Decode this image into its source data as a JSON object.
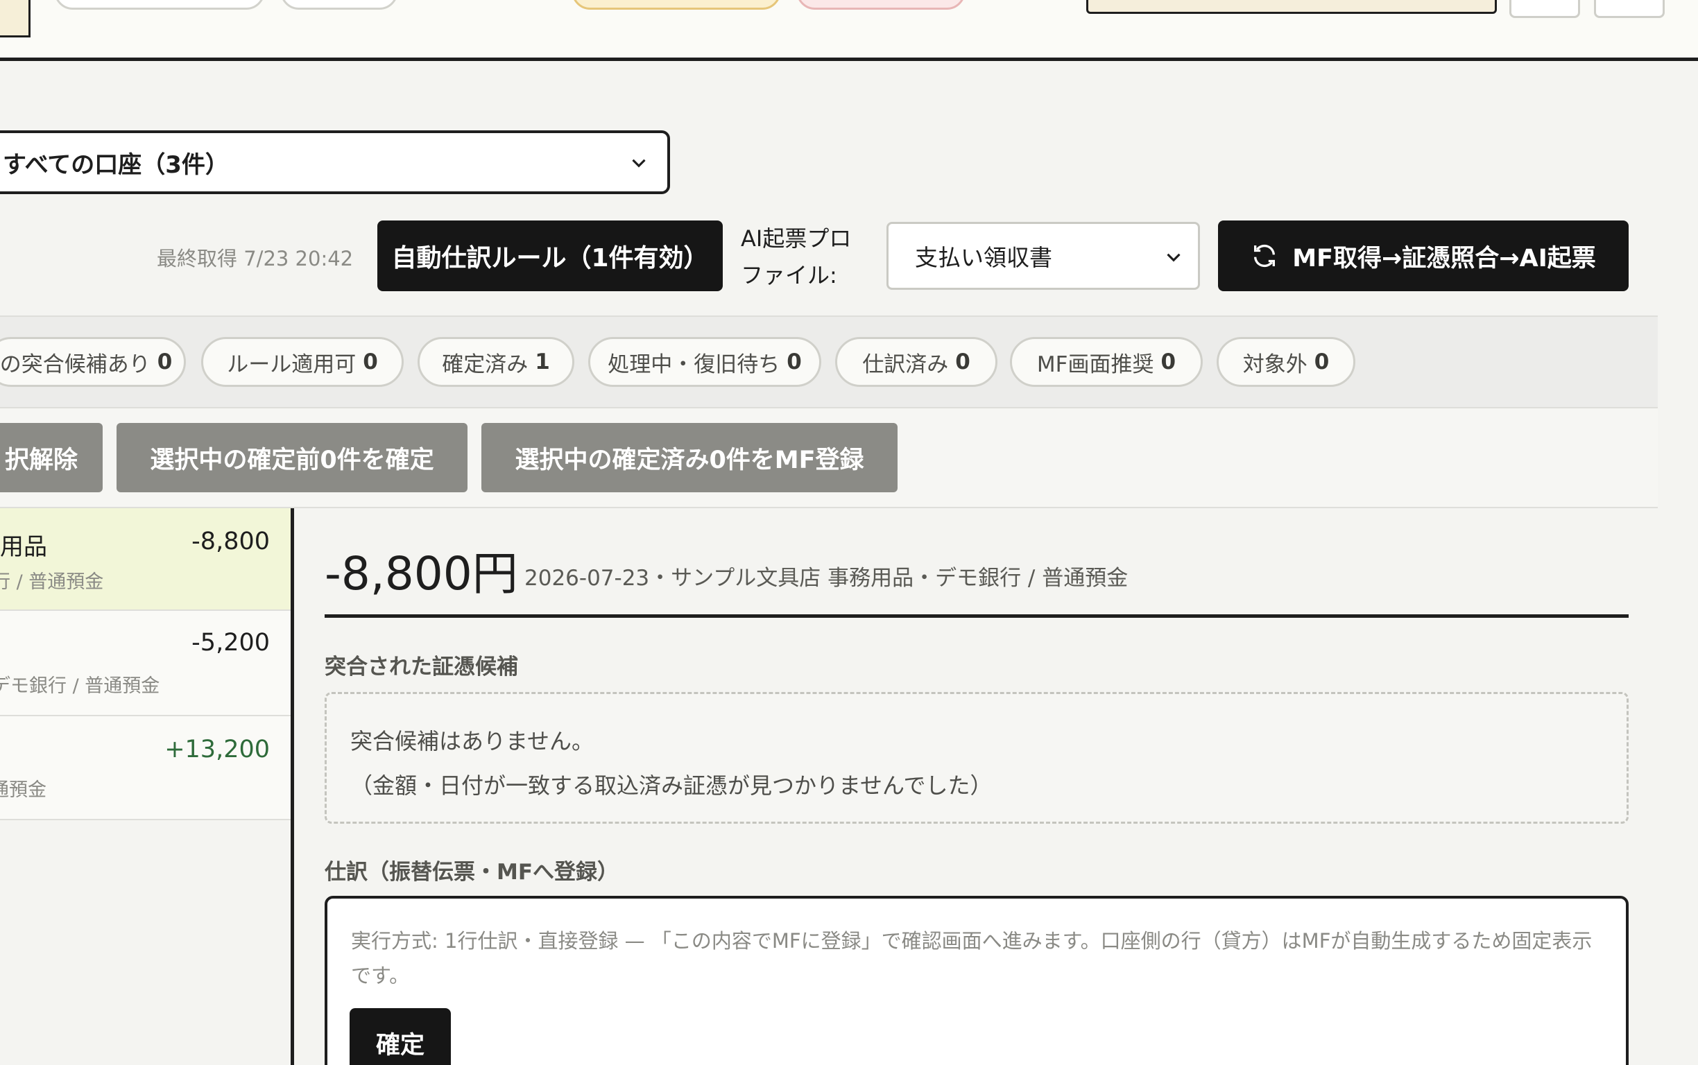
{
  "account_filter": {
    "selected": "すべての口座（3件）"
  },
  "toolbar": {
    "last_fetch": "最終取得 7/23 20:42",
    "rule_button": "自動仕訳ルール（1件有効）",
    "profile_label": "AI起票プロファイル:",
    "profile_selected": "支払い領収書",
    "run_button": "MF取得→証憑照合→AI起票"
  },
  "filters": [
    {
      "label": "の突合候補あり",
      "count": "0"
    },
    {
      "label": "ルール適用可",
      "count": "0"
    },
    {
      "label": "確定済み",
      "count": "1"
    },
    {
      "label": "処理中・復旧待ち",
      "count": "0"
    },
    {
      "label": "仕訳済み",
      "count": "0"
    },
    {
      "label": "MF画面推奨",
      "count": "0"
    },
    {
      "label": "対象外",
      "count": "0"
    }
  ],
  "actions": {
    "clear_selection": "択解除",
    "confirm_selected": "選択中の確定前0件を確定",
    "register_selected": "選択中の確定済み0件をMF登録"
  },
  "transactions": [
    {
      "title": "用品",
      "sub": "行 / 普通預金",
      "amount": "-8,800"
    },
    {
      "title": "",
      "sub": "デモ銀行 / 普通預金",
      "amount": "-5,200"
    },
    {
      "title": "",
      "sub": "通預金",
      "amount": "+13,200"
    }
  ],
  "detail": {
    "amount": "-8,800円",
    "meta": "2026-07-23・サンプル文具店 事務用品・デモ銀行 / 普通預金",
    "matched_title": "突合された証憑候補",
    "no_match_line1": "突合候補はありません。",
    "no_match_line2": "（金額・日付が一致する取込済み証憑が見つかりませんでした）",
    "journal_title": "仕訳（振替伝票・MFへ登録）",
    "journal_note": "実行方式: 1行仕訳・直接登録 — 「この内容でMFに登録」で確認画面へ進みます。口座側の行（貸方）はMFが自動生成するため固定表示です。",
    "confirm_button": "確定"
  },
  "colors": {
    "positive": "#2e6b3a",
    "selected_row": "#f2f6d8",
    "dark": "#161616"
  }
}
